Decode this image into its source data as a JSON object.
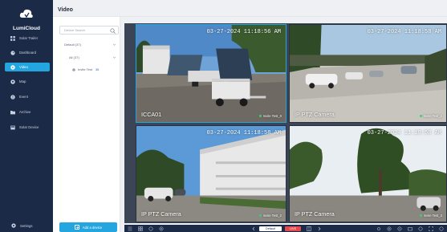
{
  "app": {
    "name": "LumiCloud"
  },
  "page": {
    "title": "Video"
  },
  "sidebar": {
    "items": [
      {
        "label": "Solar Trailer",
        "icon": "grid-icon"
      },
      {
        "label": "Dashboard",
        "icon": "dashboard-icon"
      },
      {
        "label": "Video",
        "icon": "video-icon",
        "active": true
      },
      {
        "label": "Map",
        "icon": "map-icon"
      },
      {
        "label": "Event",
        "icon": "event-icon"
      },
      {
        "label": "Archive",
        "icon": "archive-icon"
      },
      {
        "label": "Solar Device",
        "icon": "device-icon"
      }
    ],
    "settings_label": "Settings"
  },
  "panel": {
    "search_placeholder": "Device Search",
    "tree": {
      "root_label": "Default (37)",
      "group_label": "All (37)",
      "leaf_label": "Invite Test",
      "leaf_count": "35"
    },
    "add_button_label": "Add a device"
  },
  "cameras": [
    {
      "timestamp": "03-27-2024 11:18:56 AM",
      "name": "ICCA01",
      "status": "Invite Test_0",
      "selected": true
    },
    {
      "timestamp": "03-27-2024 11:18:58 AM",
      "name": "IP PTZ Camera",
      "status": "Invite Test_1",
      "selected": false
    },
    {
      "timestamp": "03-27-2024 11:18:58 AM",
      "name": "IP PTZ Camera",
      "status": "Invite Test_2",
      "selected": false
    },
    {
      "timestamp": "03-27-2024 11:18:58 AM",
      "name": "IP PTZ Camera",
      "status": "Invite Test_3",
      "selected": false
    }
  ],
  "toolbar": {
    "default_label": "Default",
    "live_label": "LIVE"
  },
  "colors": {
    "sidebar_bg": "#1b2a47",
    "accent": "#23a6e0",
    "live_red": "#e5484d",
    "online_green": "#3cd070"
  }
}
